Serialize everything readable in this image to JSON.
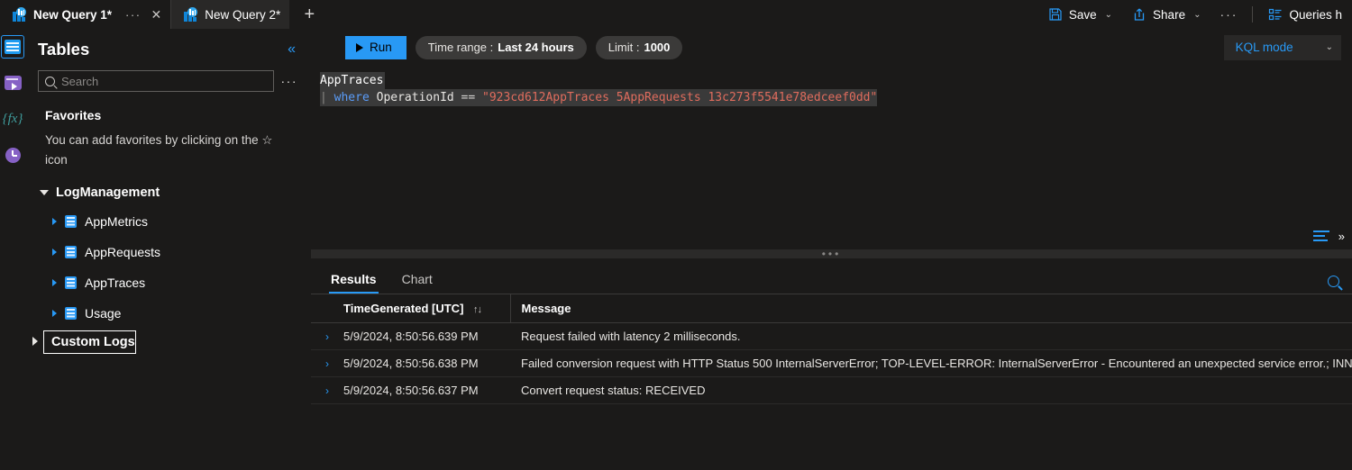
{
  "tabs": [
    {
      "title": "New Query 1*",
      "icon": "app-insights-icon",
      "modified": true,
      "active": true,
      "ellipsis": "···",
      "close": "✕"
    },
    {
      "title": "New Query 2*",
      "icon": "app-insights-icon",
      "modified": true,
      "active": false
    }
  ],
  "new_tab_label": "+",
  "topbar": {
    "save_label": "Save",
    "share_label": "Share",
    "overflow_label": "···",
    "queries_hub_label": "Queries h",
    "chevron": "⌄"
  },
  "rail": {
    "items": [
      {
        "name": "tables-rail-icon",
        "label": "Tables",
        "selected": true
      },
      {
        "name": "queries-rail-icon",
        "label": "Queries",
        "selected": false
      },
      {
        "name": "functions-rail-icon",
        "label": "{fx}",
        "selected": false
      },
      {
        "name": "history-rail-icon",
        "label": "History",
        "selected": false
      }
    ]
  },
  "sidebar": {
    "title": "Tables",
    "collapse_icon": "«",
    "overflow_icon": "···",
    "search_placeholder": "Search",
    "search_value": "",
    "favorites_title": "Favorites",
    "favorites_hint": "You can add favorites by clicking on the ☆ icon",
    "group": {
      "label": "LogManagement",
      "expanded": true,
      "tables": [
        {
          "label": "AppMetrics"
        },
        {
          "label": "AppRequests"
        },
        {
          "label": "AppTraces"
        },
        {
          "label": "Usage"
        }
      ]
    },
    "custom_logs": {
      "label": "Custom Logs",
      "expanded": false,
      "focused": true
    }
  },
  "query_toolbar": {
    "run_label": "Run",
    "time_range_label": "Time range :",
    "time_range_value": "Last 24 hours",
    "limit_label": "Limit :",
    "limit_value": "1000",
    "mode_value": "KQL mode",
    "mode_chevron": "⌄"
  },
  "editor": {
    "line1": "AppTraces",
    "line2_pipe": "|",
    "line2_keyword": "where",
    "line2_identifier": "OperationId",
    "line2_operator": "==",
    "line2_string": "\"923cd612AppTraces 5AppRequests 13c273f5541e78edceef0dd\"",
    "format_icon": "format-query-icon",
    "collapse_icon": "»"
  },
  "results": {
    "tabs": [
      {
        "label": "Results",
        "active": true
      },
      {
        "label": "Chart",
        "active": false
      }
    ],
    "search_icon": "search-icon",
    "columns": [
      "TimeGenerated [UTC]",
      "Message"
    ],
    "sort_indicator": "↑↓",
    "rows": [
      {
        "expand": "›",
        "time": "5/9/2024, 8:50:56.639 PM",
        "message": "Request failed with latency 2 milliseconds."
      },
      {
        "expand": "›",
        "time": "5/9/2024, 8:50:56.638 PM",
        "message": "Failed conversion request with HTTP Status 500 InternalServerError; TOP-LEVEL-ERROR: InternalServerError - Encountered an unexpected service error.; INNER E"
      },
      {
        "expand": "›",
        "time": "5/9/2024, 8:50:56.637 PM",
        "message": "Convert request status: RECEIVED"
      }
    ]
  },
  "colors": {
    "accent": "#2899f5",
    "background": "#1b1a19",
    "panel": "#292827",
    "string_token": "#e06c5d",
    "keyword_token": "#5a9cf8"
  }
}
